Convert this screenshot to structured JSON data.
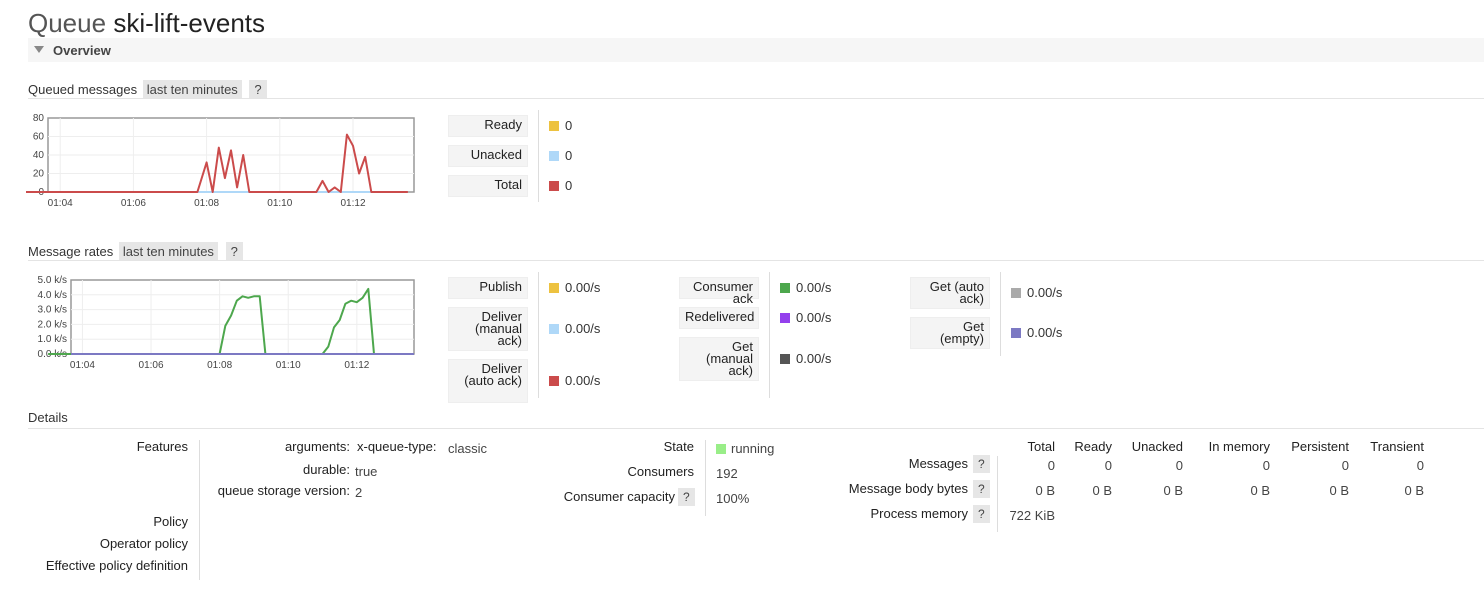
{
  "page": {
    "title_prefix": "Queue",
    "queue_name": "ski-lift-events",
    "overview_label": "Overview"
  },
  "queued": {
    "heading": "Queued messages",
    "range": "last ten minutes",
    "help": "?",
    "chart_data": {
      "type": "line",
      "title": "",
      "x": [
        "01:03",
        "01:04",
        "01:05",
        "01:06",
        "01:07",
        "01:07:30",
        "01:07:45",
        "01:08",
        "01:08:10",
        "01:08:20",
        "01:08:30",
        "01:08:40",
        "01:08:50",
        "01:09",
        "01:09:10",
        "01:09:20",
        "01:09:30",
        "01:10",
        "01:10:30",
        "01:11",
        "01:11:10",
        "01:11:20",
        "01:11:30",
        "01:11:40",
        "01:11:50",
        "01:12",
        "01:12:10",
        "01:12:20",
        "01:12:30",
        "01:12:40",
        "01:12:50",
        "01:13",
        "01:13:30"
      ],
      "xticks": [
        "01:04",
        "01:06",
        "01:08",
        "01:10",
        "01:12"
      ],
      "yticks": [
        0,
        20,
        40,
        60,
        80
      ],
      "ylim": [
        0,
        80
      ],
      "xlim": [
        "01:03:40",
        "01:13:40"
      ],
      "series": [
        {
          "name": "Ready",
          "color": "#edc240",
          "values": [
            0,
            0,
            0,
            0,
            0,
            0,
            0,
            0,
            0,
            0,
            0,
            0,
            0,
            0,
            0,
            0,
            0,
            0,
            0,
            0,
            0,
            0,
            0,
            0,
            0,
            0,
            0,
            0,
            0,
            0,
            0,
            0,
            0
          ]
        },
        {
          "name": "Unacked",
          "color": "#afd8f8",
          "values": [
            0,
            0,
            0,
            0,
            0,
            0,
            0,
            0,
            0,
            0,
            0,
            0,
            0,
            0,
            0,
            0,
            0,
            0,
            0,
            0,
            0,
            0,
            0,
            0,
            0,
            0,
            0,
            0,
            0,
            0,
            0,
            0,
            0
          ]
        },
        {
          "name": "Total",
          "color": "#cb4b4b",
          "values": [
            0,
            0,
            0,
            0,
            0,
            0,
            0,
            32,
            0,
            48,
            15,
            45,
            5,
            40,
            0,
            0,
            0,
            0,
            0,
            0,
            12,
            0,
            5,
            0,
            62,
            50,
            20,
            38,
            0,
            0,
            0,
            0,
            0
          ]
        }
      ]
    },
    "legend": [
      {
        "label": "Ready",
        "value": "0",
        "color": "#edc240"
      },
      {
        "label": "Unacked",
        "value": "0",
        "color": "#afd8f8"
      },
      {
        "label": "Total",
        "value": "0",
        "color": "#cb4b4b"
      }
    ]
  },
  "rates": {
    "heading": "Message rates",
    "range": "last ten minutes",
    "help": "?",
    "chart_data": {
      "type": "line",
      "title": "",
      "x": [
        "01:03",
        "01:04",
        "01:05",
        "01:06",
        "01:07",
        "01:07:40",
        "01:08",
        "01:08:10",
        "01:08:20",
        "01:08:30",
        "01:08:40",
        "01:08:50",
        "01:09",
        "01:09:10",
        "01:09:20",
        "01:10",
        "01:10:30",
        "01:11",
        "01:11:10",
        "01:11:20",
        "01:11:30",
        "01:11:40",
        "01:11:50",
        "01:12",
        "01:12:10",
        "01:12:20",
        "01:12:30",
        "01:13",
        "01:13:30"
      ],
      "xticks": [
        "01:04",
        "01:06",
        "01:08",
        "01:10",
        "01:12"
      ],
      "yticks": [
        "0.0 k/s",
        "1.0 k/s",
        "2.0 k/s",
        "3.0 k/s",
        "4.0 k/s",
        "5.0 k/s"
      ],
      "ylim": [
        0,
        5.0
      ],
      "xlim": [
        "01:03:40",
        "01:13:40"
      ],
      "series": [
        {
          "name": "Consumer ack",
          "color": "#4da74d",
          "values": [
            0,
            0,
            0,
            0,
            0,
            0,
            0,
            1.9,
            2.6,
            3.6,
            3.9,
            3.8,
            3.9,
            3.9,
            0,
            0,
            0,
            0,
            0.5,
            1.8,
            2.3,
            3.4,
            3.6,
            3.5,
            3.8,
            4.4,
            0,
            0,
            0
          ]
        }
      ]
    },
    "legend_col1": [
      {
        "label": "Publish",
        "value": "0.00/s",
        "color": "#edc240"
      },
      {
        "label": "Deliver (manual ack)",
        "value": "0.00/s",
        "color": "#afd8f8"
      },
      {
        "label": "Deliver (auto ack)",
        "value": "0.00/s",
        "color": "#cb4b4b"
      }
    ],
    "legend_col2": [
      {
        "label": "Consumer ack",
        "value": "0.00/s",
        "color": "#4da74d"
      },
      {
        "label": "Redelivered",
        "value": "0.00/s",
        "color": "#9440ed"
      },
      {
        "label": "Get (manual ack)",
        "value": "0.00/s",
        "color": "#555555"
      }
    ],
    "legend_col3": [
      {
        "label": "Get (auto ack)",
        "value": "0.00/s",
        "color": "#aaaaaa"
      },
      {
        "label": "Get (empty)",
        "value": "0.00/s",
        "color": "#7c79c3"
      }
    ]
  },
  "details": {
    "heading": "Details",
    "features_label": "Features",
    "arguments_key": "arguments:",
    "arguments_value": "x-queue-type:",
    "arguments_sub": "classic",
    "durable_key": "durable:",
    "durable_value": "true",
    "storage_key": "queue storage version:",
    "storage_value": "2",
    "policy_label": "Policy",
    "operator_policy_label": "Operator policy",
    "effective_policy_label": "Effective policy definition",
    "state_label": "State",
    "state_value": "running",
    "consumers_label": "Consumers",
    "consumers_value": "192",
    "capacity_label": "Consumer capacity",
    "capacity_value": "100%",
    "help": "?",
    "table": {
      "headers": [
        "Total",
        "Ready",
        "Unacked",
        "In memory",
        "Persistent",
        "Transient"
      ],
      "rows": [
        {
          "label": "Messages",
          "values": [
            "0",
            "0",
            "0",
            "0",
            "0",
            "0"
          ]
        },
        {
          "label": "Message body bytes",
          "values": [
            "0 B",
            "0 B",
            "0 B",
            "0 B",
            "0 B",
            "0 B"
          ]
        },
        {
          "label": "Process memory",
          "values": [
            "722 KiB"
          ]
        }
      ]
    }
  }
}
